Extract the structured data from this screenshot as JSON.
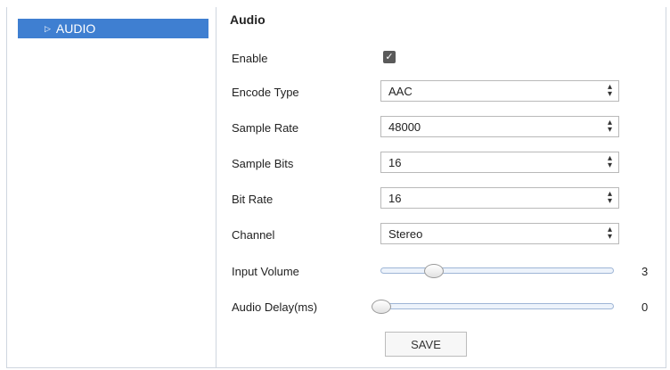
{
  "sidebar": {
    "items": [
      {
        "label": "AUDIO",
        "icon": "triangle-right-icon",
        "active": true
      }
    ]
  },
  "main": {
    "title": "Audio",
    "enable": {
      "label": "Enable",
      "checked": true
    },
    "encode_type": {
      "label": "Encode Type",
      "value": "AAC"
    },
    "sample_rate": {
      "label": "Sample Rate",
      "value": "48000"
    },
    "sample_bits": {
      "label": "Sample Bits",
      "value": "16"
    },
    "bit_rate": {
      "label": "Bit Rate",
      "value": "16"
    },
    "channel": {
      "label": "Channel",
      "value": "Stereo"
    },
    "input_volume": {
      "label": "Input Volume",
      "value": "3"
    },
    "audio_delay": {
      "label": "Audio Delay(ms)",
      "value": "0"
    },
    "save_label": "SAVE"
  },
  "colors": {
    "accent": "#3f7fd1",
    "border": "#cfd6df",
    "slider_track": "#edf3fb"
  }
}
